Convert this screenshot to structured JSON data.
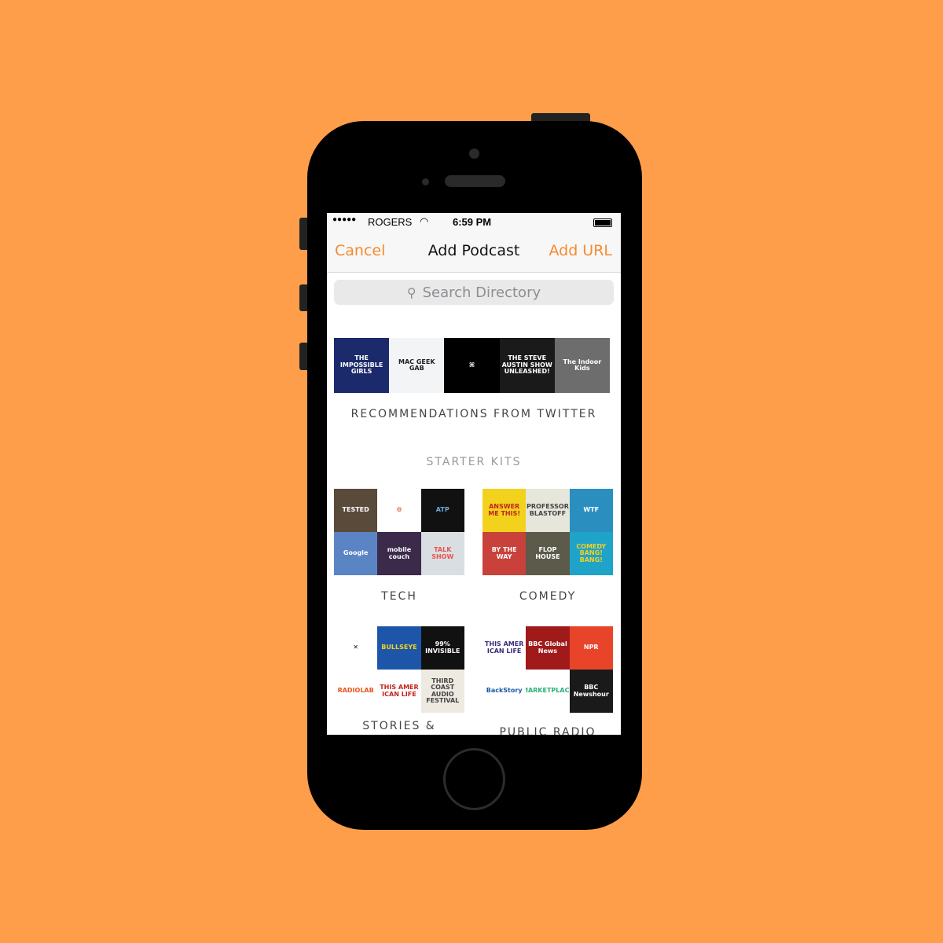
{
  "status_bar": {
    "signal": "●●●●●",
    "carrier": "ROGERS",
    "time": "6:59 PM"
  },
  "nav": {
    "cancel": "Cancel",
    "title": "Add Podcast",
    "add_url": "Add URL"
  },
  "search": {
    "placeholder": "Search Directory"
  },
  "recommendations": {
    "label": "RECOMMENDATIONS FROM TWITTER",
    "items": [
      {
        "title": "THE IMPOSSIBLE GIRLS",
        "bg": "#1a2a6a",
        "fg": "#fff"
      },
      {
        "title": "MAC GEEK GAB",
        "bg": "#f2f4f6",
        "fg": "#222"
      },
      {
        "title": "⌘",
        "bg": "#000",
        "fg": "#fff"
      },
      {
        "title": "THE STEVE AUSTIN SHOW UNLEASHED!",
        "bg": "#1a1a1a",
        "fg": "#fff"
      },
      {
        "title": "The Indoor Kids",
        "bg": "#6d6d6d",
        "fg": "#fff"
      }
    ]
  },
  "starter_kits": {
    "heading": "STARTER KITS",
    "kits": [
      {
        "label": "TECH",
        "tiles": [
          {
            "title": "TESTED",
            "bg": "#5a4a3a",
            "fg": "#fff"
          },
          {
            "title": "⚙",
            "bg": "#fff",
            "fg": "#e8401c"
          },
          {
            "title": "ATP",
            "bg": "#111",
            "fg": "#6fa8dc"
          },
          {
            "title": "Google",
            "bg": "#5b84c4",
            "fg": "#fff"
          },
          {
            "title": "mobile couch",
            "bg": "#3b2a4a",
            "fg": "#fff"
          },
          {
            "title": "TALK SHOW",
            "bg": "#d9dee2",
            "fg": "#e8544e"
          }
        ]
      },
      {
        "label": "COMEDY",
        "tiles": [
          {
            "title": "ANSWER ME THIS!",
            "bg": "#f2d21c",
            "fg": "#c0241c"
          },
          {
            "title": "PROFESSOR BLASTOFF",
            "bg": "#e6e6da",
            "fg": "#444"
          },
          {
            "title": "WTF",
            "bg": "#2a8fbf",
            "fg": "#fff"
          },
          {
            "title": "BY THE WAY",
            "bg": "#c8413a",
            "fg": "#fff"
          },
          {
            "title": "FLOP HOUSE",
            "bg": "#5c5a4a",
            "fg": "#fff"
          },
          {
            "title": "COMEDY BANG! BANG!",
            "bg": "#1fa3c9",
            "fg": "#f4d21c"
          }
        ]
      },
      {
        "label": "STORIES &",
        "tiles": [
          {
            "title": "✕",
            "bg": "#fff",
            "fg": "#111"
          },
          {
            "title": "BULLSEYE",
            "bg": "#1d56a8",
            "fg": "#f4d21c"
          },
          {
            "title": "99% INVISIBLE",
            "bg": "#111",
            "fg": "#fff"
          },
          {
            "title": "RADIOLAB",
            "bg": "#fff",
            "fg": "#e8541c"
          },
          {
            "title": "THIS AMER ICAN LIFE",
            "bg": "#fff",
            "fg": "#c0241c"
          },
          {
            "title": "THIRD COAST AUDIO FESTIVAL",
            "bg": "#eeeae2",
            "fg": "#444"
          }
        ]
      },
      {
        "label": "PUBLIC RADIO",
        "tiles": [
          {
            "title": "THIS AMER ICAN LIFE",
            "bg": "#fff",
            "fg": "#3a2a7a"
          },
          {
            "title": "BBC Global News",
            "bg": "#a01a1a",
            "fg": "#fff"
          },
          {
            "title": "NPR",
            "bg": "#e8442a",
            "fg": "#fff"
          },
          {
            "title": "BackStory",
            "bg": "#fff",
            "fg": "#1a5aa8"
          },
          {
            "title": "MARKETPLACE",
            "bg": "#fff",
            "fg": "#2ab07a"
          },
          {
            "title": "BBC Newshour",
            "bg": "#1a1a1a",
            "fg": "#fff"
          }
        ]
      }
    ]
  },
  "colors": {
    "accent": "#f68a2e",
    "background": "#fe9d4a"
  }
}
